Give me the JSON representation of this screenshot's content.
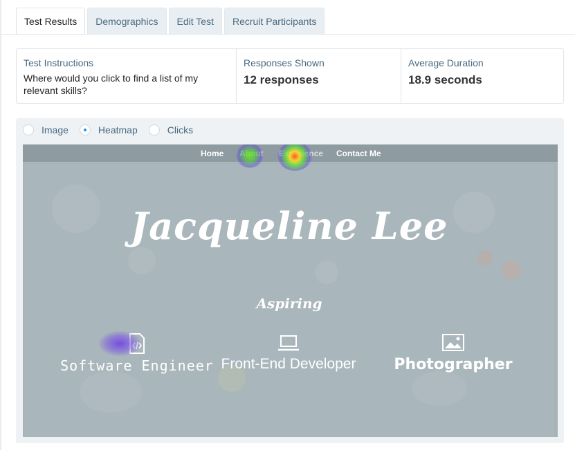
{
  "tabs": [
    "Test Results",
    "Demographics",
    "Edit Test",
    "Recruit Participants"
  ],
  "info": {
    "instructions_label": "Test Instructions",
    "instructions_text": "Where would you click to find a list of my relevant skills?",
    "responses_label": "Responses Shown",
    "responses_value": "12 responses",
    "duration_label": "Average Duration",
    "duration_value": "18.9 seconds"
  },
  "view_options": {
    "image": "Image",
    "heatmap": "Heatmap",
    "clicks": "Clicks",
    "selected": "Heatmap"
  },
  "site": {
    "nav": [
      "Home",
      "About",
      "Experience",
      "Contact Me"
    ],
    "name": "Jacqueline Lee",
    "tagline": "Aspiring",
    "roles": [
      {
        "label": "Software Engineer",
        "icon": "code-file-icon"
      },
      {
        "label": "Front-End Developer",
        "icon": "laptop-icon"
      },
      {
        "label": "Photographer",
        "icon": "image-icon"
      }
    ]
  },
  "colors": {
    "tab_text": "#4a6a80",
    "radio_accent": "#1d8ef0",
    "panel_bg": "#eef2f5"
  }
}
